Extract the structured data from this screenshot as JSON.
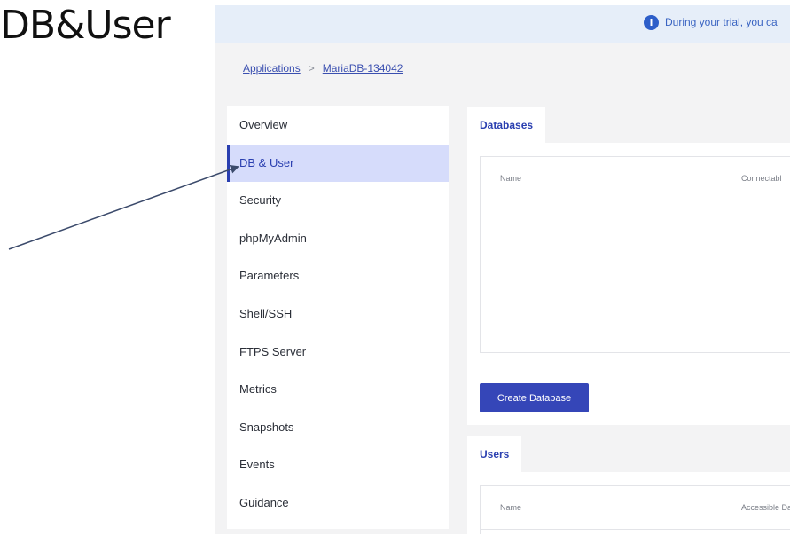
{
  "slide": {
    "title": "DB&User"
  },
  "banner": {
    "icon": "info-icon",
    "text": "During your trial, you ca"
  },
  "breadcrumb": {
    "applications": "Applications",
    "separator": ">",
    "current": "MariaDB-134042"
  },
  "sidebar": {
    "items": [
      {
        "label": "Overview",
        "active": false
      },
      {
        "label": "DB & User",
        "active": true
      },
      {
        "label": "Security",
        "active": false
      },
      {
        "label": "phpMyAdmin",
        "active": false
      },
      {
        "label": "Parameters",
        "active": false
      },
      {
        "label": "Shell/SSH",
        "active": false
      },
      {
        "label": "FTPS Server",
        "active": false
      },
      {
        "label": "Metrics",
        "active": false
      },
      {
        "label": "Snapshots",
        "active": false
      },
      {
        "label": "Events",
        "active": false
      },
      {
        "label": "Guidance",
        "active": false
      }
    ]
  },
  "databases": {
    "tab": "Databases",
    "columns": {
      "name": "Name",
      "second": "Connectabl"
    },
    "create_button": "Create Database"
  },
  "users": {
    "tab": "Users",
    "columns": {
      "name": "Name",
      "second": "Accessible Da"
    }
  },
  "colors": {
    "accent": "#2a3fb0",
    "active_bg": "#d6dcfb",
    "banner_bg": "#e6eef9",
    "button": "#3546b8"
  }
}
